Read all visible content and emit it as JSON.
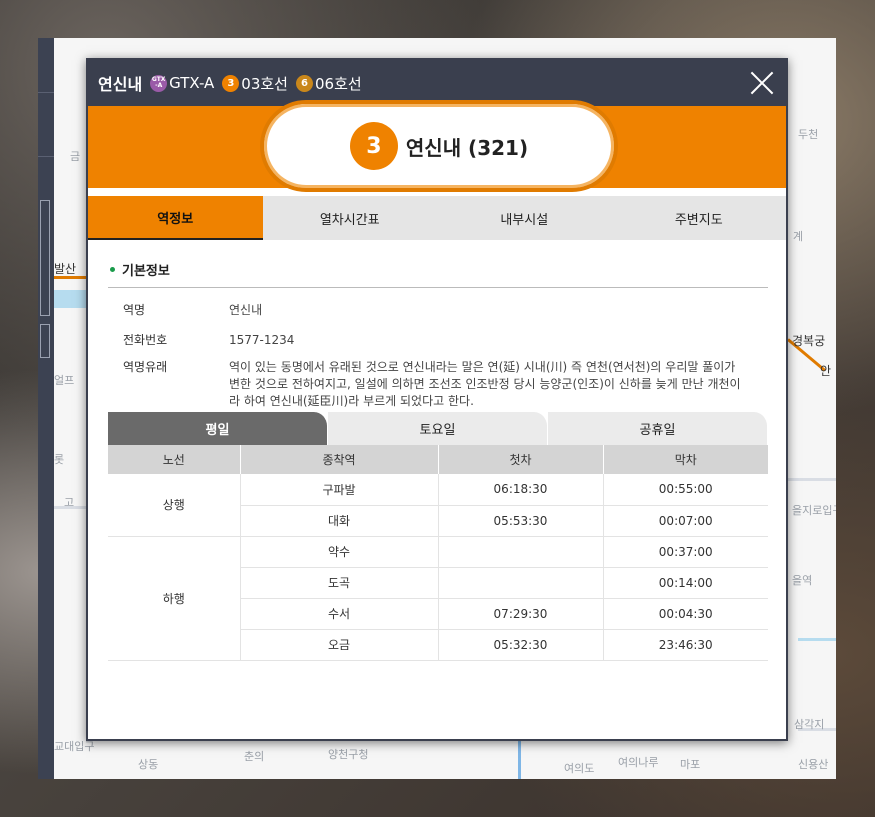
{
  "background": {
    "map_labels": [
      "금",
      "발산",
      "얼프",
      "고",
      "롯",
      "두천",
      "계",
      "경복궁",
      "안",
      "을지로입구",
      "을역",
      "삼각지",
      "교대입구",
      "상동",
      "춘의",
      "양천구청",
      "여의도",
      "여의나루",
      "마포",
      "신용산"
    ]
  },
  "header": {
    "station_name": "연신내",
    "lines": [
      {
        "dot": "GTX-A",
        "label": "GTX-A",
        "color": "#9a5ba8"
      },
      {
        "dot": "3",
        "label": "03호선",
        "color": "#ef8200"
      },
      {
        "dot": "6",
        "label": "06호선",
        "color": "#c9871b"
      }
    ]
  },
  "banner": {
    "line_number": "3",
    "station_title": "연신내 (321)",
    "color": "#ef8200"
  },
  "tabs": [
    "역정보",
    "열차시간표",
    "내부시설",
    "주변지도"
  ],
  "info": {
    "section_title": "기본정보",
    "rows": [
      {
        "key": "역명",
        "value": "연신내"
      },
      {
        "key": "전화번호",
        "value": "1577-1234"
      },
      {
        "key": "역명유래",
        "value": "역이 있는 동명에서 유래된 것으로 연신내라는 말은 연(延) 시내(川) 즉 연천(연서천)의 우리말 풀이가 변한 것으로 전하여지고, 일설에 의하면 조선조 인조반정 당시 능양군(인조)이 신하를 늦게 만난 개천이라 하여 연신내(延臣川)라 부르게 되었다고 한다."
      }
    ]
  },
  "day_tabs": [
    "평일",
    "토요일",
    "공휴일"
  ],
  "timetable": {
    "headers": [
      "노선",
      "종착역",
      "첫차",
      "막차"
    ],
    "groups": [
      {
        "direction": "상행",
        "rows": [
          {
            "dest": "구파발",
            "first": "06:18:30",
            "last": "00:55:00"
          },
          {
            "dest": "대화",
            "first": "05:53:30",
            "last": "00:07:00"
          }
        ]
      },
      {
        "direction": "하행",
        "rows": [
          {
            "dest": "약수",
            "first": "",
            "last": "00:37:00"
          },
          {
            "dest": "도곡",
            "first": "",
            "last": "00:14:00"
          },
          {
            "dest": "수서",
            "first": "07:29:30",
            "last": "00:04:30"
          },
          {
            "dest": "오금",
            "first": "05:32:30",
            "last": "23:46:30"
          }
        ]
      }
    ]
  }
}
